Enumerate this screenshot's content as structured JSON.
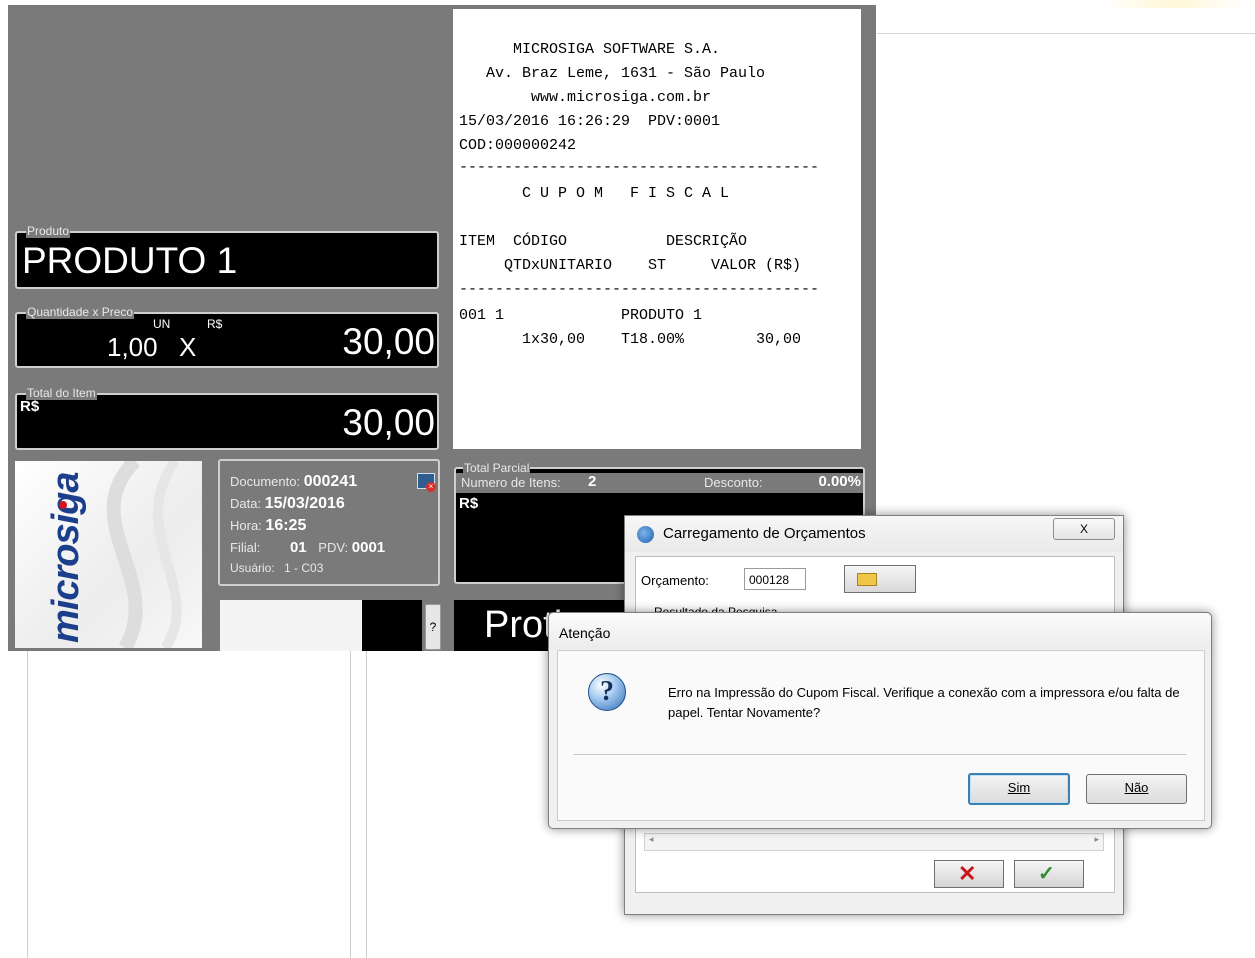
{
  "pos": {
    "produto": {
      "legend": "Produto",
      "value": "PRODUTO 1"
    },
    "qty_price": {
      "legend": "Quantidade x Preco",
      "unit": "UN",
      "currency": "R$",
      "quantity": "1,00",
      "times": "X",
      "price": "30,00"
    },
    "total_item": {
      "legend": "Total do Item",
      "currency": "R$",
      "value": "30,00"
    },
    "logo_text": "microsiga",
    "info": {
      "documento_label": "Documento:",
      "documento": "000241",
      "data_label": "Data:",
      "data": "15/03/2016",
      "hora_label": "Hora:",
      "hora": "16:25",
      "filial_label": "Filial:",
      "filial": "01",
      "pdv_label": "PDV:",
      "pdv": "0001",
      "usuario_label": "Usuário:",
      "usuario": "1 - C03"
    },
    "total_parcial": {
      "legend": "Total Parcial",
      "num_itens_label": "Numero de Itens:",
      "num_itens": "2",
      "desconto_label": "Desconto:",
      "desconto": "0.00%",
      "currency": "R$"
    },
    "help_button": "?",
    "bottom_text": "Proth"
  },
  "receipt": {
    "lines": [
      "      MICROSIGA SOFTWARE S.A.",
      "   Av. Braz Leme, 1631 - São Paulo",
      "        www.microsiga.com.br",
      "15/03/2016 16:26:29  PDV:0001",
      "COD:000000242",
      "----------------------------------------",
      "       C U P O M   F I S C A L",
      "",
      "ITEM  CÓDIGO           DESCRIÇÃO",
      "     QTDxUNITARIO    ST     VALOR (R$)",
      "----------------------------------------",
      "001 1             PRODUTO 1",
      "       1x30,00    T18.00%        30,00"
    ]
  },
  "orcamentos_dialog": {
    "title": "Carregamento de Orçamentos",
    "close": "X",
    "orcamento_label": "Orçamento:",
    "orcamento_value": "000128",
    "resultado_label": "Resultado da Pesquisa"
  },
  "atencao_dialog": {
    "title": "Atenção",
    "message": "Erro na Impressão do Cupom Fiscal. Verifique a conexão com a impressora e/ou falta de papel. Tentar Novamente?",
    "yes_label": "Sim",
    "no_label": "Não"
  }
}
